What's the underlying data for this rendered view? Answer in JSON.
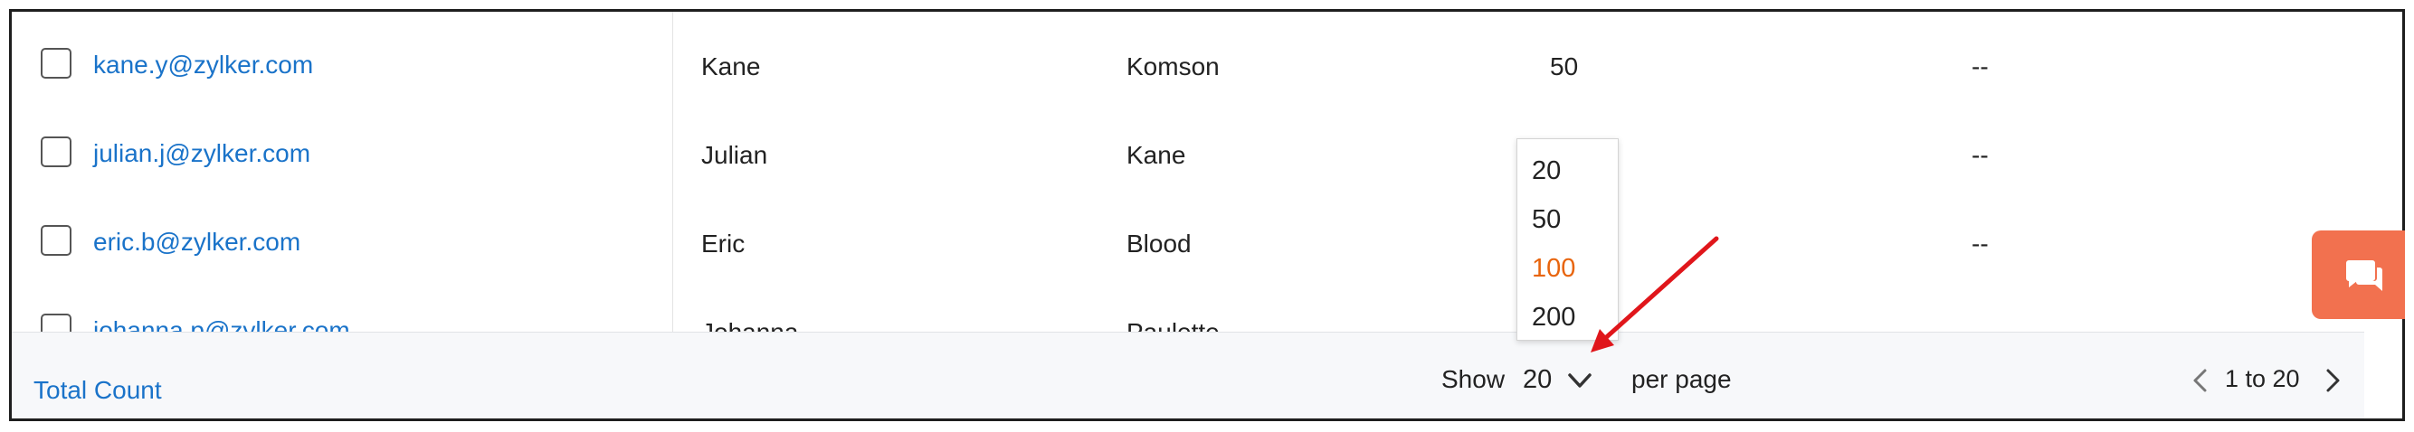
{
  "rows": [
    {
      "email": "kane.y@zylker.com",
      "first": "Kane",
      "last": "Komson",
      "count": "50",
      "extra": "--"
    },
    {
      "email": "julian.j@zylker.com",
      "first": "Julian",
      "last": "Kane",
      "count": "",
      "extra": "--"
    },
    {
      "email": "eric.b@zylker.com",
      "first": "Eric",
      "last": "Blood",
      "count": "",
      "extra": "--"
    },
    {
      "email": "johanna.p@zylker.com",
      "first": "Johanna",
      "last": "Paulette",
      "count": "",
      "extra": ""
    }
  ],
  "footer": {
    "total_label": "Total Count",
    "show_label": "Show",
    "selected_page_size": "20",
    "per_page_label": "per page",
    "range_text": "1 to 20"
  },
  "dropdown": {
    "options": [
      "20",
      "50",
      "100",
      "200"
    ],
    "highlighted": "100"
  },
  "colors": {
    "link": "#1a73c9",
    "highlight": "#e8650e",
    "chat_button": "#f2714f",
    "annotation_arrow": "#e0161b"
  },
  "icons": {
    "chat": "chat-bubbles-icon",
    "prev": "chevron-left-icon",
    "next": "chevron-right-icon",
    "select": "chevron-down-icon"
  }
}
